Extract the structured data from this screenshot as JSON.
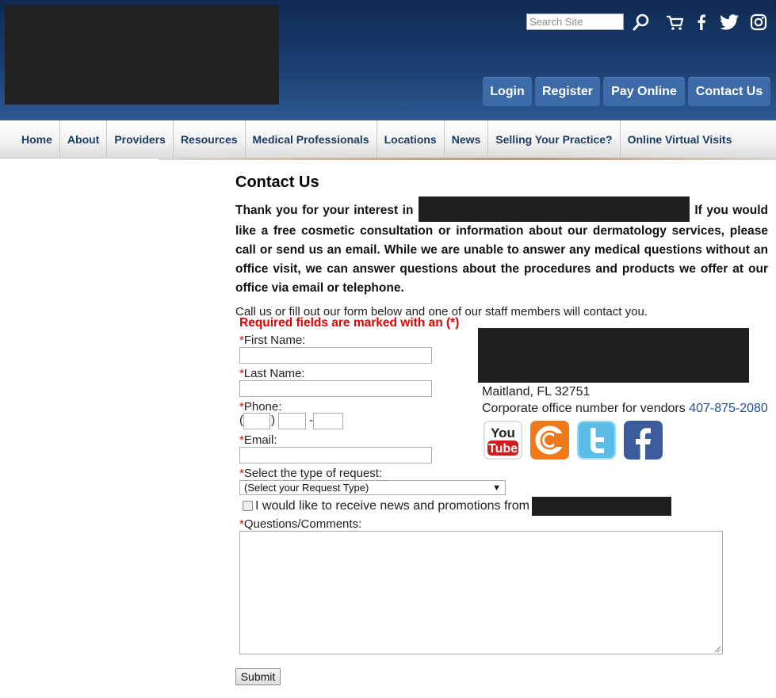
{
  "header": {
    "search_placeholder": "Search Site",
    "buttons": {
      "login": "Login",
      "register": "Register",
      "pay_online": "Pay Online",
      "contact_us": "Contact Us"
    }
  },
  "nav": {
    "items": [
      "Home",
      "About",
      "Providers",
      "Resources",
      "Medical Professionals",
      "Locations",
      "News",
      "Selling Your Practice?",
      "Online Virtual Visits"
    ]
  },
  "main": {
    "title": "Contact Us",
    "intro_before": "Thank you for your interest in",
    "intro_after": "If you would like a free cosmetic consultation or information about our dermatology services, please call or send us an email. While we are unable to answer any medical questions without an office visit, we can answer questions about the procedures and products we offer at our office via email or telephone.",
    "call_line": "Call us or fill out our form below and one of our staff members will contact you.",
    "required_note": "Required fields are marked with an (*)"
  },
  "form": {
    "first_name_label": "First Name:",
    "last_name_label": "Last Name:",
    "phone_label": "Phone:",
    "email_label": "Email:",
    "request_type_label": "Select the type of request:",
    "request_type_selected": "(Select your Request Type)",
    "news_checkbox_label": "I would like to receive news and promotions from",
    "comments_label": "Questions/Comments:",
    "submit_label": "Submit",
    "required_mark": "*",
    "phone_open": "(",
    "phone_close": ")",
    "phone_dash": "-"
  },
  "contact_info": {
    "city_line": "Maitland, FL 32751",
    "corporate_text": "Corporate office number for vendors",
    "corporate_phone": "407-875-2080"
  },
  "social": {
    "icons": [
      "youtube-icon",
      "citysearch-icon",
      "twitter-icon",
      "facebook-icon"
    ]
  },
  "colors": {
    "header_bg": "#1b3e70",
    "button_bg": "#3c6ba7",
    "nav_text": "#1b3a66",
    "required_red": "#e00000",
    "link_blue": "#1d4f9a"
  }
}
